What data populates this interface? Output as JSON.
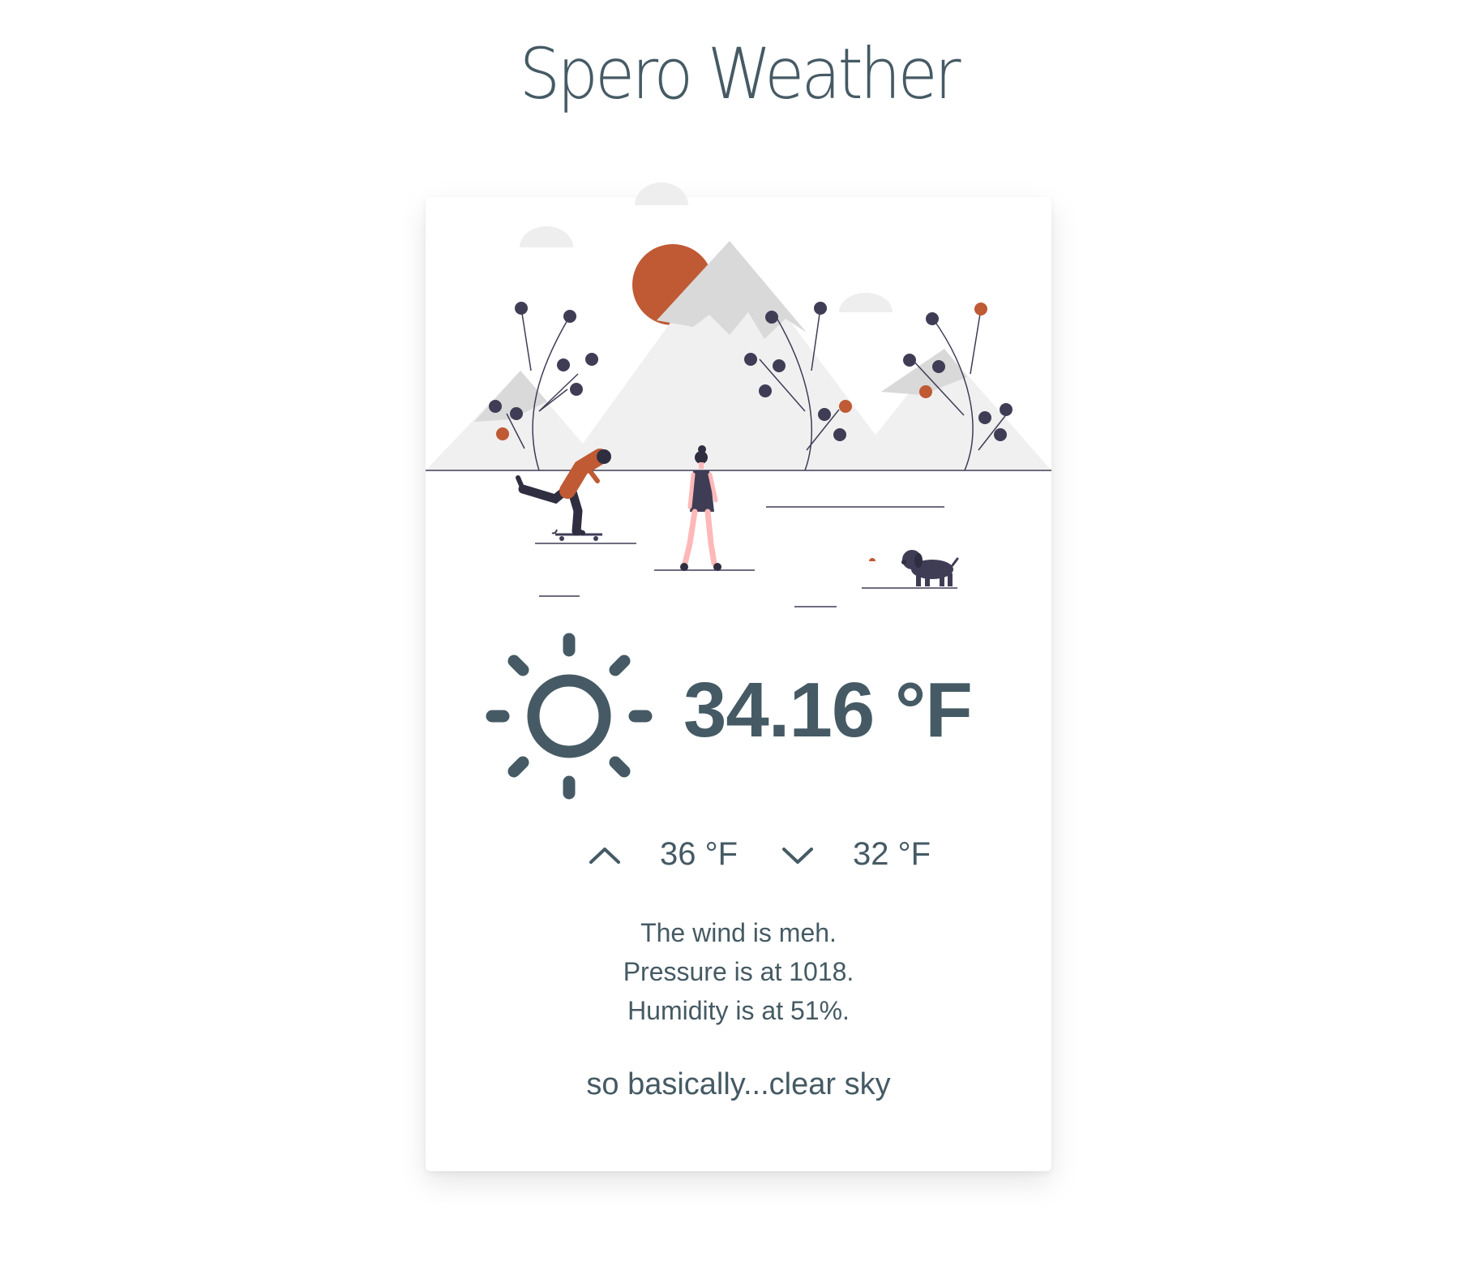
{
  "app": {
    "title": "Spero Weather"
  },
  "weather": {
    "icon": "sun-icon",
    "temperature": "34.16 °F",
    "high": "36 °F",
    "low": "32 °F",
    "details": [
      "The wind is meh.",
      "Pressure is at 1018.",
      "Humidity is at 51%."
    ],
    "summary": "so basically...clear sky"
  },
  "illustration": {
    "name": "winter-mountains-illustration",
    "colors": {
      "accent": "#bf5a34",
      "dark": "#3f3d56",
      "mountain_light": "#f0f0f0",
      "mountain_shade": "#d9d9d9",
      "cloud": "#eeeeee"
    }
  },
  "colors": {
    "text": "#455a64",
    "background": "#ffffff",
    "card": "#ffffff"
  }
}
